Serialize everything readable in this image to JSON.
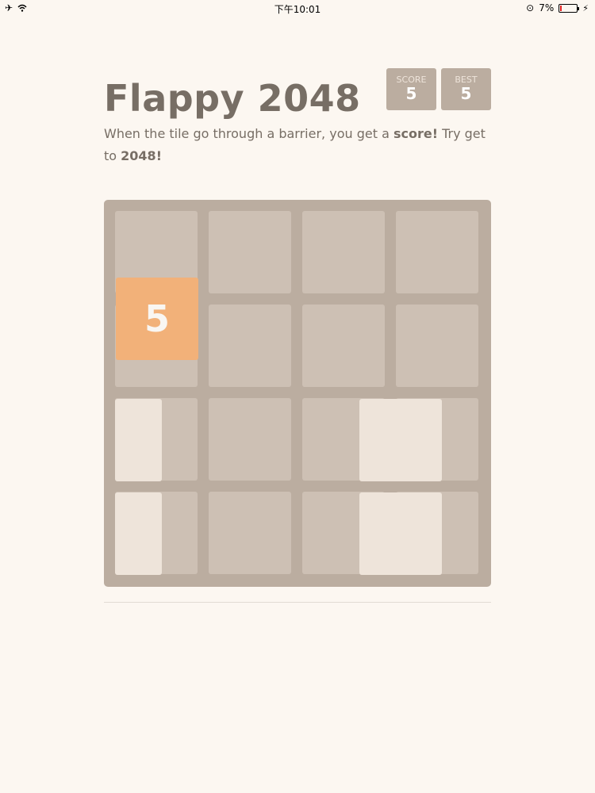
{
  "status_bar": {
    "left_icons": [
      "airplane-icon",
      "wifi-icon"
    ],
    "time": "下午10:01",
    "battery_percent": "7%",
    "battery_level": 0.07
  },
  "header": {
    "title": "Flappy 2048",
    "score_label": "SCORE",
    "score_value": "5",
    "best_label": "BEST",
    "best_value": "5"
  },
  "intro": {
    "text_1": "When the tile go through a barrier, you get a ",
    "bold_1": "score!",
    "text_2": " Try get to ",
    "bold_2": "2048!"
  },
  "board": {
    "grid_size": 4,
    "tile_value": "5",
    "colors": {
      "board": "#bbada0",
      "cell": "#cdc0b4",
      "barrier": "#eee4da",
      "tile": "#f2b179"
    }
  }
}
